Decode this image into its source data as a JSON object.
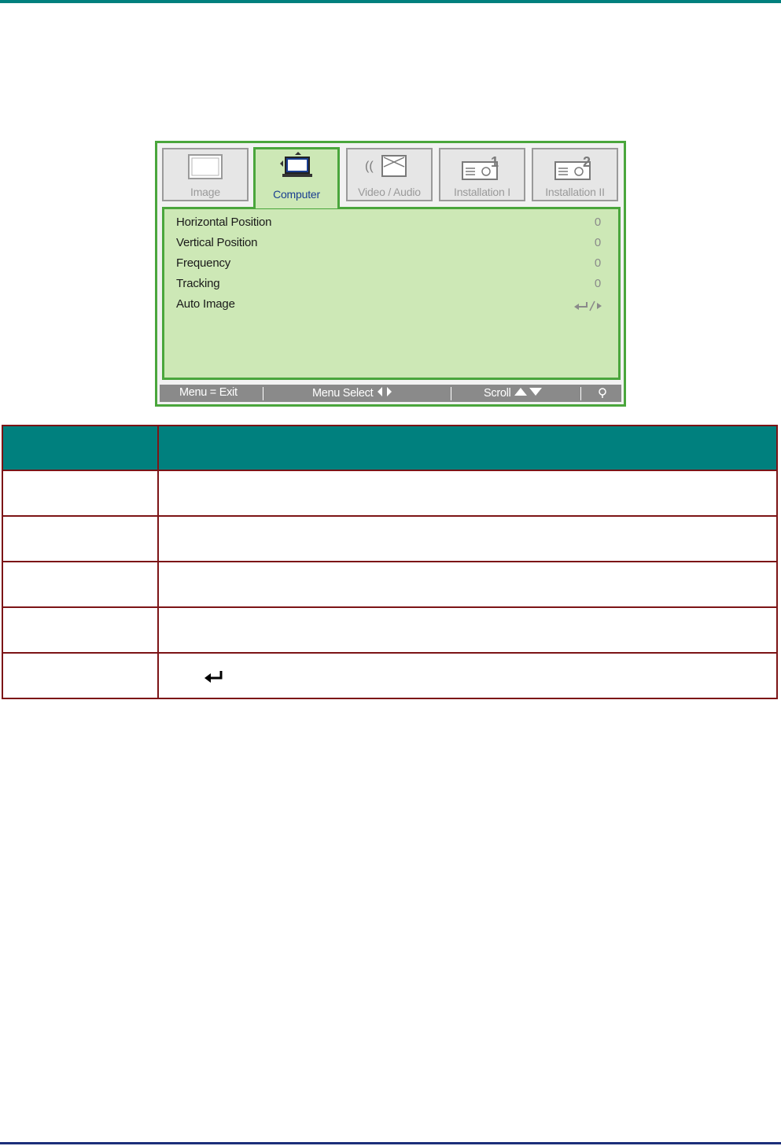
{
  "osd": {
    "tabs": [
      {
        "label": "Image",
        "icon": "monitor-icon",
        "active": false
      },
      {
        "label": "Computer",
        "icon": "computer-icon",
        "active": true
      },
      {
        "label": "Video / Audio",
        "icon": "video-audio-icon",
        "active": false
      },
      {
        "label": "Installation I",
        "icon": "projector-1-icon",
        "active": false
      },
      {
        "label": "Installation II",
        "icon": "projector-2-icon",
        "active": false
      }
    ],
    "menu_items": [
      {
        "label": "Horizontal Position",
        "value": "0"
      },
      {
        "label": "Vertical Position",
        "value": "0"
      },
      {
        "label": "Frequency",
        "value": "0"
      },
      {
        "label": "Tracking",
        "value": "0"
      },
      {
        "label": "Auto Image",
        "value_icon": "enter-right-icon"
      }
    ],
    "footer": {
      "exit": "Menu = Exit",
      "select": "Menu Select",
      "scroll": "Scroll",
      "icon": "lamp-icon"
    },
    "colors": {
      "border": "#4aa63c",
      "panel": "#cde8b6",
      "active_text": "#1a3e90",
      "footer": "#8a8a8a"
    }
  },
  "table": {
    "header_color": "#00807e",
    "border_color": "#7c1416",
    "rows": 5,
    "row5_icon": "enter-icon"
  },
  "page": {
    "top_rule_color": "#00807e",
    "bottom_rule_color": "#1c2f7a"
  }
}
